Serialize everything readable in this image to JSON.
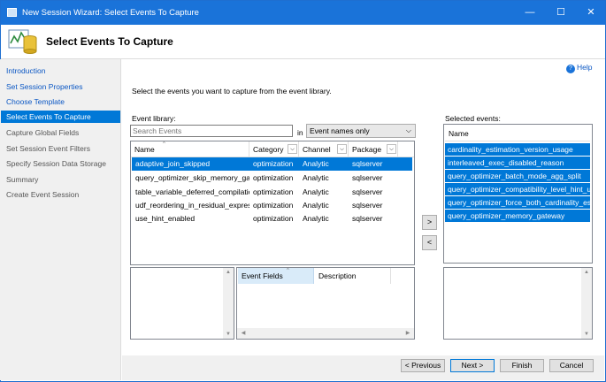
{
  "window": {
    "title": "New Session Wizard: Select Events To Capture",
    "minimize_icon": "—",
    "maximize_icon": "☐",
    "close_icon": "✕"
  },
  "header": {
    "title": "Select Events To Capture"
  },
  "help": {
    "icon": "?",
    "label": "Help"
  },
  "sidebar": {
    "items": [
      {
        "label": "Introduction",
        "state": "link"
      },
      {
        "label": "Set Session Properties",
        "state": "link"
      },
      {
        "label": "Choose Template",
        "state": "link"
      },
      {
        "label": "Select Events To Capture",
        "state": "selected"
      },
      {
        "label": "Capture Global Fields",
        "state": "disabled"
      },
      {
        "label": "Set Session Event Filters",
        "state": "disabled"
      },
      {
        "label": "Specify Session Data Storage",
        "state": "disabled"
      },
      {
        "label": "Summary",
        "state": "disabled"
      },
      {
        "label": "Create Event Session",
        "state": "disabled"
      }
    ]
  },
  "main": {
    "instruction": "Select the events you want to capture from the event library.",
    "library_label": "Event library:",
    "search_placeholder": "Search Events",
    "in_label": "in",
    "filter_value": "Event names only",
    "selected_label": "Selected events:"
  },
  "library": {
    "columns": [
      "Name",
      "Category",
      "Channel",
      "Package"
    ],
    "rows": [
      {
        "name": "adaptive_join_skipped",
        "category": "optimization",
        "channel": "Analytic",
        "package": "sqlserver",
        "selected": true
      },
      {
        "name": "query_optimizer_skip_memory_gateway",
        "category": "optimization",
        "channel": "Analytic",
        "package": "sqlserver",
        "selected": false
      },
      {
        "name": "table_variable_deferred_compilation",
        "category": "optimization",
        "channel": "Analytic",
        "package": "sqlserver",
        "selected": false
      },
      {
        "name": "udf_reordering_in_residual_expression",
        "category": "optimization",
        "channel": "Analytic",
        "package": "sqlserver",
        "selected": false
      },
      {
        "name": "use_hint_enabled",
        "category": "optimization",
        "channel": "Analytic",
        "package": "sqlserver",
        "selected": false
      }
    ]
  },
  "move": {
    "add": ">",
    "remove": "<"
  },
  "selected_events": {
    "column": "Name",
    "items": [
      "cardinality_estimation_version_usage",
      "interleaved_exec_disabled_reason",
      "query_optimizer_batch_mode_agg_split",
      "query_optimizer_compatibility_level_hint_usage",
      "query_optimizer_force_both_cardinality_estimation_behaviors",
      "query_optimizer_memory_gateway"
    ]
  },
  "details": {
    "event_fields_label": "Event Fields",
    "description_label": "Description"
  },
  "buttons": {
    "previous": "< Previous",
    "next": "Next >",
    "finish": "Finish",
    "cancel": "Cancel"
  },
  "colors": {
    "accent": "#0078d7",
    "titlebar": "#1a73d9",
    "link": "#0b57c4"
  }
}
